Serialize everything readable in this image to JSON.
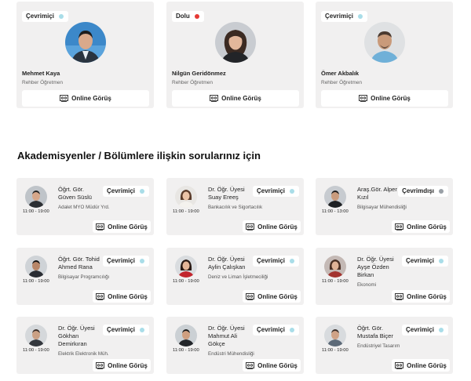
{
  "button_label": "Online Görüş",
  "status_colors": {
    "online": "#a9dde8",
    "busy": "#e53935",
    "offline": "#9aa0a6"
  },
  "top_cards": [
    {
      "status": "Çevrimiçi",
      "status_type": "online",
      "name": "Mehmet Kaya",
      "role": "Rehber Öğretmen"
    },
    {
      "status": "Dolu",
      "status_type": "busy",
      "name": "Nilgün Geridönmez",
      "role": "Rehber Öğretmen"
    },
    {
      "status": "Çevrimiçi",
      "status_type": "online",
      "name": "Ömer Akbalık",
      "role": "Rehber Öğretmen"
    }
  ],
  "section_title": "Akademisyenler / Bölümlere ilişkin sorularınız için",
  "academic_cards": [
    {
      "name": "Öğrt. Gör.\nGüven Süslü",
      "status": "Çevrimiçi",
      "status_type": "online",
      "department": "Adalet MYO Müdür Yrd.",
      "hours": "11:00 - 19:00"
    },
    {
      "name": "Dr. Öğr. Üyesi\nSuay Ereeş",
      "status": "Çevrimiçi",
      "status_type": "online",
      "department": "Bankacılık ve Sigortacılık",
      "hours": "11:00 - 19:00"
    },
    {
      "name": "Araş.Gör. Alper\nKızıl",
      "status": "Çevrimdışı",
      "status_type": "offline",
      "department": "Bilgisayar Mühendisliği",
      "hours": "11:00 - 13:00"
    },
    {
      "name": "Öğrt. Gör. Tohid\nAhmed Rana",
      "status": "Çevrimiçi",
      "status_type": "online",
      "department": "Bilgisayar Programcılığı",
      "hours": "11:00 - 19:00"
    },
    {
      "name": "Dr. Öğr. Üyesi\nAylin Çalışkan",
      "status": "Çevrimiçi",
      "status_type": "online",
      "department": "Deniz ve Liman İşletmeciliği",
      "hours": "11:00 - 19:00"
    },
    {
      "name": "Dr. Öğr. Üyesi\nAyşe Özden\nBirkan",
      "status": "Çevrimiçi",
      "status_type": "online",
      "department": "Ekonomi",
      "hours": "11:00 - 19:00"
    },
    {
      "name": "Dr. Öğr. Üyesi\nGökhan\nDemirkıran",
      "status": "Çevrimiçi",
      "status_type": "online",
      "department": "Elektrik Elektronik Müh.",
      "hours": "11:00 - 19:00"
    },
    {
      "name": "Dr. Öğr. Üyesi\nMahmut Ali\nGökçe",
      "status": "Çevrimiçi",
      "status_type": "online",
      "department": "Endüstri Mühendisliği",
      "hours": "11:00 - 19:00"
    },
    {
      "name": "Öğrt. Gör.\nMustafa Biçer",
      "status": "Çevrimiçi",
      "status_type": "online",
      "department": "Endüstriyel Tasarım",
      "hours": "11:00 - 19:00"
    }
  ]
}
